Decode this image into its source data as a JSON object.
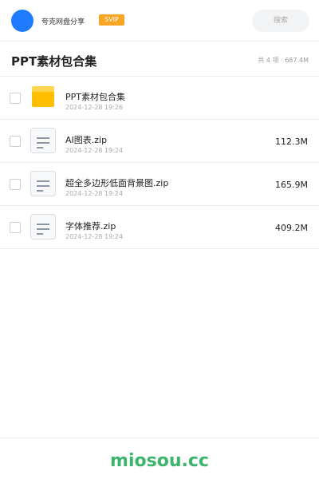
{
  "header_bar": {
    "brand": "夸克网盘分享",
    "badge": "SVIP",
    "search_placeholder": "搜索"
  },
  "folder": {
    "title": "PPT素材包合集",
    "summary": "共 4 项 · 687.4M"
  },
  "items": [
    {
      "type": "folder",
      "name": "PPT素材包合集",
      "date": "2024-12-28 19:26",
      "size": ""
    },
    {
      "type": "file",
      "name": "AI图表.zip",
      "date": "2024-12-28 19:24",
      "size": "112.3M"
    },
    {
      "type": "file",
      "name": "超全多边形低面背景图.zip",
      "date": "2024-12-28 19:24",
      "size": "165.9M"
    },
    {
      "type": "file",
      "name": "字体推荐.zip",
      "date": "2024-12-28 19:24",
      "size": "409.2M"
    }
  ],
  "footer": {
    "watermark": "miosou.cc"
  },
  "colors": {
    "accent": "#1e7bff",
    "badge": "#f6a623",
    "folder": "#ffbf00",
    "watermark": "#3cb46a"
  },
  "icons": {
    "folder": "folder-icon",
    "file": "zip-file-icon"
  }
}
